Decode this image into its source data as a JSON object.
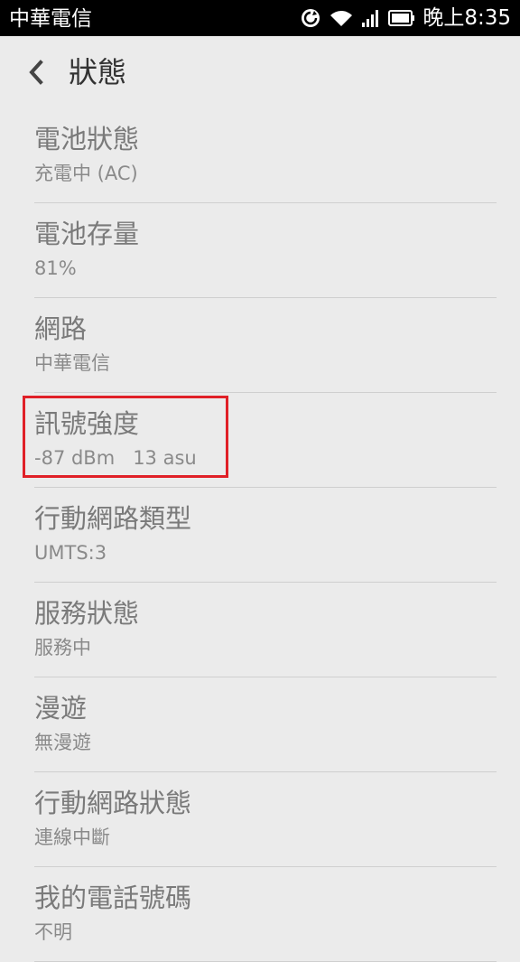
{
  "statusbar": {
    "carrier": "中華電信",
    "time": "晚上8:35",
    "icons": [
      "sync-icon",
      "wifi-icon",
      "signal-icon",
      "battery-icon"
    ]
  },
  "header": {
    "title": "狀態",
    "back_icon": "chevron-left-icon"
  },
  "items": [
    {
      "title": "電池狀態",
      "value": "充電中 (AC)"
    },
    {
      "title": "電池存量",
      "value": "81%"
    },
    {
      "title": "網路",
      "value": "中華電信"
    },
    {
      "title": "訊號強度",
      "value": "-87 dBm   13 asu"
    },
    {
      "title": "行動網路類型",
      "value": "UMTS:3"
    },
    {
      "title": "服務狀態",
      "value": "服務中"
    },
    {
      "title": "漫遊",
      "value": "無漫遊"
    },
    {
      "title": "行動網路狀態",
      "value": "連線中斷"
    },
    {
      "title": "我的電話號碼",
      "value": "不明"
    }
  ],
  "colors": {
    "highlight": "#e02027",
    "background": "#ebebeb"
  }
}
